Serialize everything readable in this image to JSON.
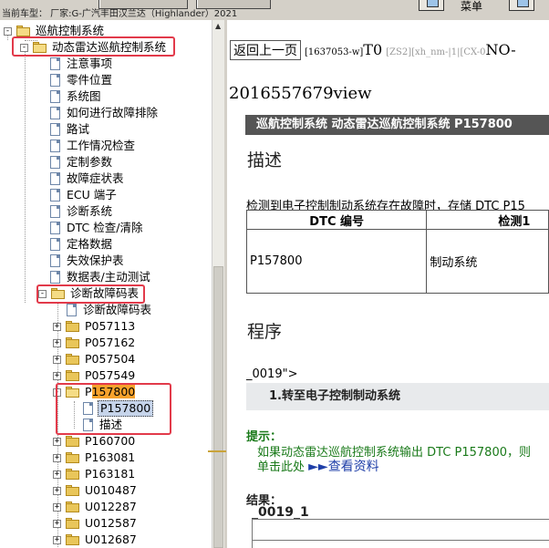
{
  "topbar": {
    "vehicle_info": "当前车型：  厂家:G-广汽丰田汉兰达（Highlander）2021",
    "menu_label": "菜单"
  },
  "tree": {
    "items": [
      {
        "label": "巡航控制系统",
        "kind": "folder",
        "expander": "-"
      },
      {
        "label": "动态雷达巡航控制系统",
        "kind": "folder",
        "expander": "-"
      },
      {
        "label": "注意事项",
        "kind": "doc"
      },
      {
        "label": "零件位置",
        "kind": "doc"
      },
      {
        "label": "系统图",
        "kind": "doc"
      },
      {
        "label": "如何进行故障排除",
        "kind": "doc"
      },
      {
        "label": "路试",
        "kind": "doc"
      },
      {
        "label": "工作情况检查",
        "kind": "doc"
      },
      {
        "label": "定制参数",
        "kind": "doc"
      },
      {
        "label": "故障症状表",
        "kind": "doc"
      },
      {
        "label": "ECU 端子",
        "kind": "doc"
      },
      {
        "label": "诊断系统",
        "kind": "doc"
      },
      {
        "label": "DTC 检查/清除",
        "kind": "doc"
      },
      {
        "label": "定格数据",
        "kind": "doc"
      },
      {
        "label": "失效保护表",
        "kind": "doc"
      },
      {
        "label": "数据表/主动测试",
        "kind": "doc"
      },
      {
        "label": "诊断故障码表",
        "kind": "folder",
        "expander": "-"
      },
      {
        "label": "诊断故障码表",
        "kind": "doc"
      },
      {
        "label": "P057113",
        "kind": "folder",
        "expander": "+"
      },
      {
        "label": "P057162",
        "kind": "folder",
        "expander": "+"
      },
      {
        "label": "P057504",
        "kind": "folder",
        "expander": "+"
      },
      {
        "label": "P057549",
        "kind": "folder",
        "expander": "+"
      },
      {
        "label_prefix": "P",
        "label_highlight": "157800",
        "kind": "folder",
        "expander": "-"
      },
      {
        "label": "P157800",
        "kind": "doc",
        "selected": true
      },
      {
        "label": "描述",
        "kind": "doc"
      },
      {
        "label": "P160700",
        "kind": "folder",
        "expander": "+"
      },
      {
        "label": "P163081",
        "kind": "folder",
        "expander": "+"
      },
      {
        "label": "P163181",
        "kind": "folder",
        "expander": "+"
      },
      {
        "label": "U010487",
        "kind": "folder",
        "expander": "+"
      },
      {
        "label": "U012287",
        "kind": "folder",
        "expander": "+"
      },
      {
        "label": "U012587",
        "kind": "folder",
        "expander": "+"
      },
      {
        "label": "U012687",
        "kind": "folder",
        "expander": "+"
      }
    ]
  },
  "content": {
    "back_link": "返回上一页",
    "doc_id": "[1637053-w]",
    "t0": "T0",
    "zs2": "[ZS2][xh_nm-|1|[CX-0",
    "no_text": "NO-",
    "view_id": "2016557679view",
    "title_bar": "巡航控制系统  动态雷达巡航控制系统  P157800",
    "desc_heading": "描述",
    "desc_text": "检测到电子控制制动系统存在故障时，存储 DTC P15",
    "table": {
      "headers": [
        "DTC 编号",
        "检测1"
      ],
      "rows": [
        [
          "P157800",
          "制动系统"
        ]
      ]
    },
    "procedure_heading": "程序",
    "step_ref": "_0019\">",
    "step1": "1.转至电子控制制动系统",
    "hint_label": "提示：",
    "hint_line1": "如果动态雷达巡航控制系统输出 DTC P157800，则",
    "hint_line2_prefix": "单击此处 ",
    "hint_arrows": "►►",
    "hint_link": "查看资料",
    "result_label": "结果：",
    "result_id": "_0019_1"
  },
  "colors": {
    "highlight_box": "#e23a4a",
    "tree_highlight": "#f7a22c",
    "title_bar_bg": "#555555",
    "hint_text": "#1a7a1a",
    "link": "#1f3fa8"
  }
}
